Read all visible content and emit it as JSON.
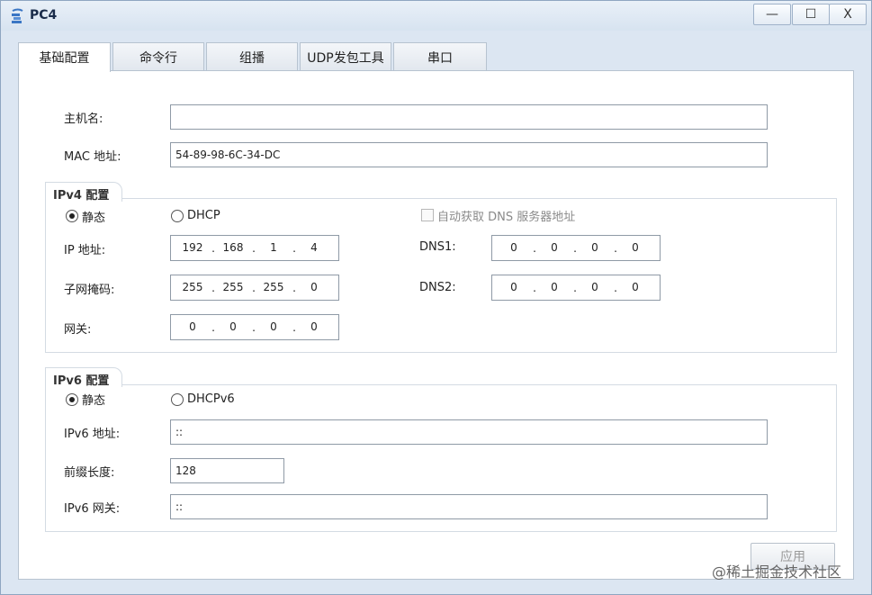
{
  "window": {
    "title": "PC4",
    "minimize_glyph": "—",
    "maximize_glyph": "☐",
    "close_glyph": "X"
  },
  "tabs": [
    {
      "label": "基础配置",
      "active": true
    },
    {
      "label": "命令行"
    },
    {
      "label": "组播"
    },
    {
      "label": "UDP发包工具"
    },
    {
      "label": "串口"
    }
  ],
  "host": {
    "hostname_label": "主机名:",
    "hostname_value": "",
    "mac_label": "MAC 地址:",
    "mac_value": "54-89-98-6C-34-DC"
  },
  "ipv4": {
    "group_title": "IPv4 配置",
    "static_label": "静态",
    "dhcp_label": "DHCP",
    "auto_dns_label": "自动获取 DNS 服务器地址",
    "ip_label": "IP 地址:",
    "ip": [
      "192",
      "168",
      "1",
      "4"
    ],
    "mask_label": "子网掩码:",
    "mask": [
      "255",
      "255",
      "255",
      "0"
    ],
    "gateway_label": "网关:",
    "gateway": [
      "0",
      "0",
      "0",
      "0"
    ],
    "dns1_label": "DNS1:",
    "dns1": [
      "0",
      "0",
      "0",
      "0"
    ],
    "dns2_label": "DNS2:",
    "dns2": [
      "0",
      "0",
      "0",
      "0"
    ],
    "dot": "."
  },
  "ipv6": {
    "group_title": "IPv6 配置",
    "static_label": "静态",
    "dhcp_label": "DHCPv6",
    "addr_label": "IPv6 地址:",
    "addr_value": "::",
    "prefix_label": "前缀长度:",
    "prefix_value": "128",
    "gateway_label": "IPv6 网关:",
    "gateway_value": "::"
  },
  "apply_label": "应用",
  "watermark": "@稀土掘金技术社区"
}
